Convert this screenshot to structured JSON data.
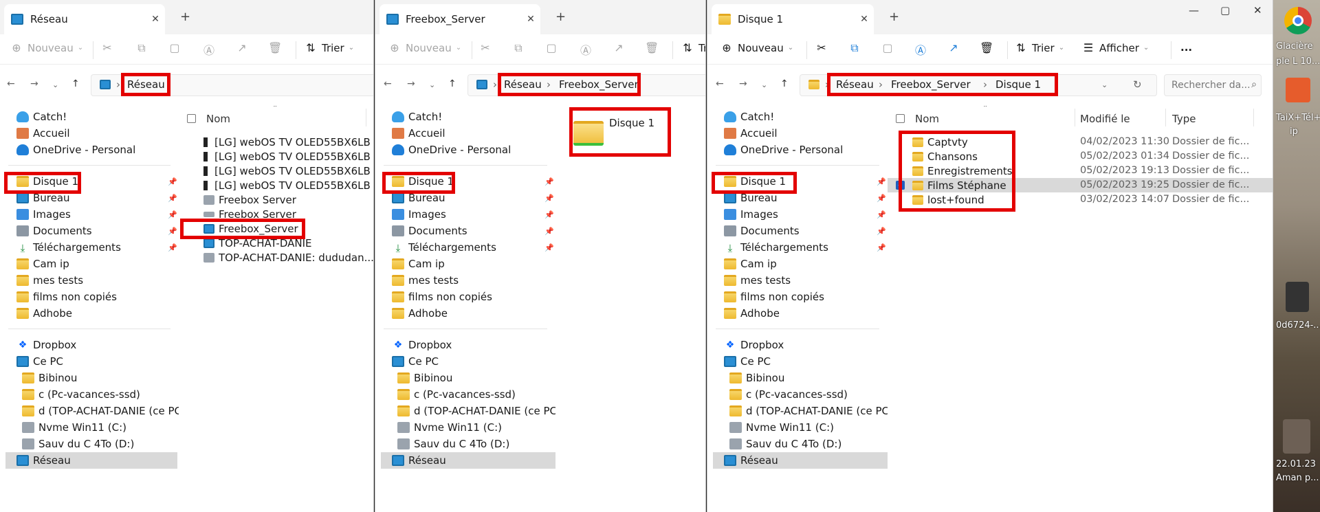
{
  "desktop": {
    "labels": [
      "Glacière",
      "ple L 10...",
      "TaiX+Tél+...",
      "ip",
      "0d6724-...",
      "22.01.23",
      "Aman p..."
    ]
  },
  "icons": {
    "tab_icon": "folder-icon",
    "network_icon": "network-icon",
    "new_icon": "plus-circle-icon",
    "cut_icon": "scissors-icon",
    "copy_icon": "copy-icon",
    "paste_icon": "clipboard-icon",
    "rename_icon": "rename-icon",
    "share_icon": "share-icon",
    "delete_icon": "trash-icon",
    "sort_icon": "sort-icon",
    "view_icon": "view-lines-icon",
    "more_icon": "ellipsis-icon"
  },
  "colors": {
    "highlight": "#e30000",
    "folder": "#f2c43c",
    "selection": "#d9d9d9",
    "accent": "#1f7fd8"
  },
  "toolbar": {
    "new_label": "Nouveau",
    "sort_label": "Trier",
    "sort_label_short": "Tr",
    "view_label": "Afficher",
    "more_label": "..."
  },
  "sidebar": {
    "quick": [
      "Catch!",
      "Accueil",
      "OneDrive - Personal"
    ],
    "pinned": [
      "Disque 1",
      "Bureau",
      "Images",
      "Documents",
      "Téléchargements"
    ],
    "folders": [
      "Cam ip",
      "mes tests",
      "films non copiés",
      "Adhobe"
    ],
    "dropbox": "Dropbox",
    "pc": "Ce PC",
    "pc_items": [
      "Bibinou",
      "c (Pc-vacances-ssd)",
      "d (TOP-ACHAT-DANIE (ce PC))",
      "Nvme  Win11 (C:)",
      "Sauv du C 4To (D:)"
    ],
    "network": "Réseau"
  },
  "window1": {
    "tab_title": "Réseau",
    "breadcrumb": [
      "Réseau"
    ],
    "col_name": "Nom",
    "items": [
      "[LG] webOS TV OLED55BX6LB",
      "[LG] webOS TV OLED55BX6LB",
      "[LG] webOS TV OLED55BX6LB",
      "[LG] webOS TV OLED55BX6LB",
      "Freebox Server",
      "Freebox Server",
      "Freebox_Server",
      "TOP-ACHAT-DANIE",
      "TOP-ACHAT-DANIE: dududan..."
    ]
  },
  "window2": {
    "tab_title": "Freebox_Server",
    "breadcrumb": [
      "Réseau",
      "Freebox_Server"
    ],
    "items": [
      "Disque 1"
    ]
  },
  "window3": {
    "tab_title": "Disque 1",
    "breadcrumb": [
      "Réseau",
      "Freebox_Server",
      "Disque 1"
    ],
    "search_placeholder": "Rechercher da...",
    "columns": {
      "name": "Nom",
      "modified": "Modifié le",
      "type": "Type"
    },
    "rows": [
      {
        "name": "Captvty",
        "date": "04/02/2023 11:30",
        "type": "Dossier de fic..."
      },
      {
        "name": "Chansons",
        "date": "05/02/2023 01:34",
        "type": "Dossier de fic..."
      },
      {
        "name": "Enregistrements",
        "date": "05/02/2023 19:13",
        "type": "Dossier de fic..."
      },
      {
        "name": "Films Stéphane",
        "date": "05/02/2023 19:25",
        "type": "Dossier de fic..."
      },
      {
        "name": "lost+found",
        "date": "03/02/2023 14:07",
        "type": "Dossier de fic..."
      }
    ],
    "selected_row_index": 3
  }
}
